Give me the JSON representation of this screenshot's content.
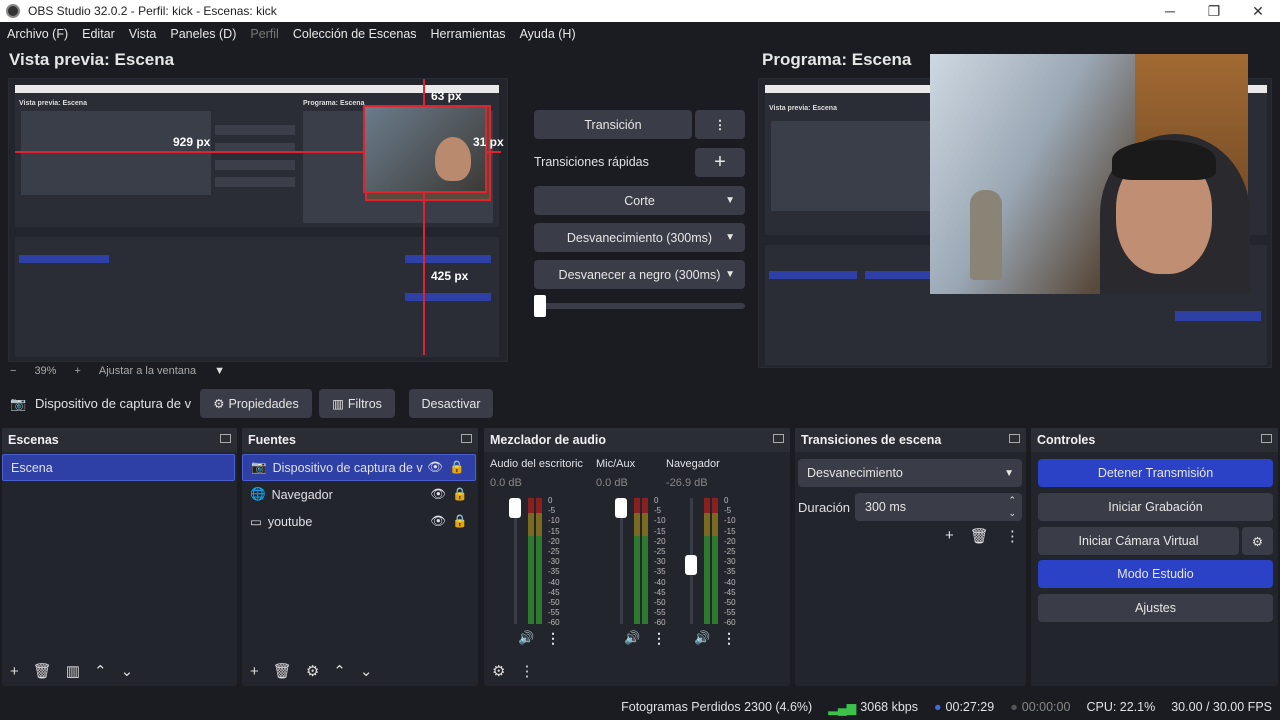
{
  "window": {
    "title": "OBS Studio 32.0.2 - Perfil: kick - Escenas: kick"
  },
  "menu": [
    "Archivo (F)",
    "Editar",
    "Vista",
    "Paneles (D)",
    "Perfil",
    "Colección de Escenas",
    "Herramientas",
    "Ayuda (H)"
  ],
  "preview": {
    "title": "Vista previa: Escena",
    "zoom": "39%",
    "fit": "Ajustar a la ventana",
    "measure_top": "63 px",
    "measure_left": "929 px",
    "measure_right": "31 px",
    "measure_bottom": "425 px"
  },
  "program": {
    "title": "Programa: Escena"
  },
  "transitions_panel": {
    "transition_btn": "Transición",
    "quick": "Transiciones rápidas",
    "items": [
      "Corte",
      "Desvanecimiento (300ms)",
      "Desvanecer a negro (300ms)"
    ]
  },
  "source_toolbar": {
    "source": "Dispositivo de captura de v",
    "properties": "Propiedades",
    "filters": "Filtros",
    "deactivate": "Desactivar"
  },
  "scenes": {
    "title": "Escenas",
    "items": [
      "Escena"
    ]
  },
  "sources": {
    "title": "Fuentes",
    "items": [
      "Dispositivo de captura de v",
      "Navegador",
      "youtube"
    ]
  },
  "mixer": {
    "title": "Mezclador de audio",
    "channels": [
      {
        "name": "Audio del escritoric",
        "db": "0.0 dB",
        "level": 0.0
      },
      {
        "name": "Mic/Aux",
        "db": "0.0 dB",
        "level": 0.0
      },
      {
        "name": "Navegador",
        "db": "-26.9 dB",
        "level": 0.45
      }
    ],
    "ticks": [
      "0",
      "-5",
      "-10",
      "-15",
      "-20",
      "-25",
      "-30",
      "-35",
      "-40",
      "-45",
      "-50",
      "-55",
      "-60"
    ]
  },
  "scene_transitions": {
    "title": "Transiciones de escena",
    "selected": "Desvanecimiento",
    "duration_label": "Duración",
    "duration_value": "300 ms"
  },
  "controls": {
    "title": "Controles",
    "stop_stream": "Detener Transmisión",
    "start_record": "Iniciar Grabación",
    "virtual_cam": "Iniciar Cámara Virtual",
    "studio_mode": "Modo Estudio",
    "settings": "Ajustes"
  },
  "status": {
    "dropped": "Fotogramas Perdidos 2300 (4.6%)",
    "bitrate": "3068 kbps",
    "live_time": "00:27:29",
    "rec_time": "00:00:00",
    "cpu": "CPU: 22.1%",
    "fps": "30.00 / 30.00 FPS"
  },
  "colors": {
    "accent": "#2b41c6",
    "guide": "#e0232e",
    "panel": "#23252c",
    "bg": "#1b1c22"
  }
}
